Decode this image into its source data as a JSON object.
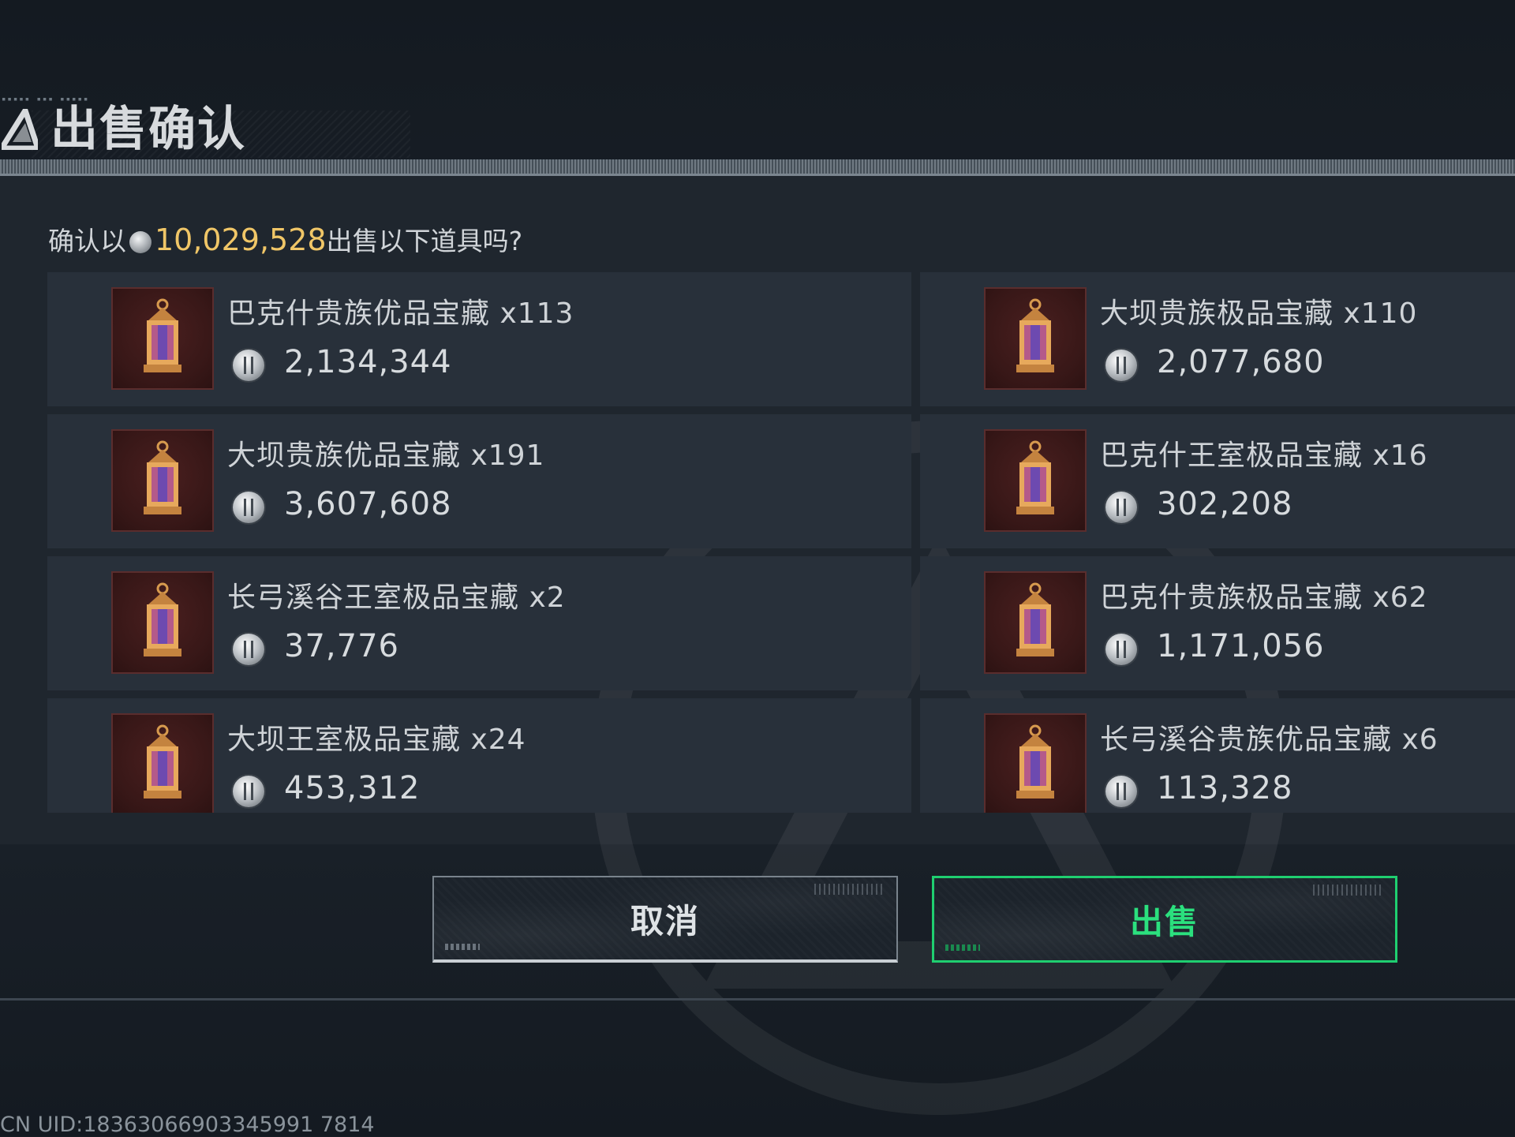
{
  "header": {
    "title": "出售确认",
    "logo_icon": "triangle-logo-icon"
  },
  "prompt": {
    "prefix": "确认以",
    "amount": "10,029,528",
    "suffix": "出售以下道具吗?",
    "currency_icon": "silver-coin-icon"
  },
  "items": [
    {
      "name": "巴克什贵族优品宝藏 x113",
      "price": "2,134,344",
      "icon": "lantern-icon"
    },
    {
      "name": "大坝贵族极品宝藏 x110",
      "price": "2,077,680",
      "icon": "lantern-icon"
    },
    {
      "name": "大坝贵族优品宝藏 x191",
      "price": "3,607,608",
      "icon": "lantern-icon"
    },
    {
      "name": "巴克什王室极品宝藏 x16",
      "price": "302,208",
      "icon": "lantern-icon"
    },
    {
      "name": "长弓溪谷王室极品宝藏 x2",
      "price": "37,776",
      "icon": "lantern-icon"
    },
    {
      "name": "巴克什贵族极品宝藏 x62",
      "price": "1,171,056",
      "icon": "lantern-icon"
    },
    {
      "name": "大坝王室极品宝藏 x24",
      "price": "453,312",
      "icon": "lantern-icon"
    },
    {
      "name": "长弓溪谷贵族优品宝藏 x6",
      "price": "113,328",
      "icon": "lantern-icon"
    }
  ],
  "buttons": {
    "cancel_label": "取消",
    "sell_label": "出售"
  },
  "footer": {
    "uid": "CN UID:18363066903345991 7814"
  },
  "colors": {
    "accent_amount": "#f0c667",
    "sell_green": "#2be07e",
    "item_thumb_bg": "#3a1818"
  }
}
